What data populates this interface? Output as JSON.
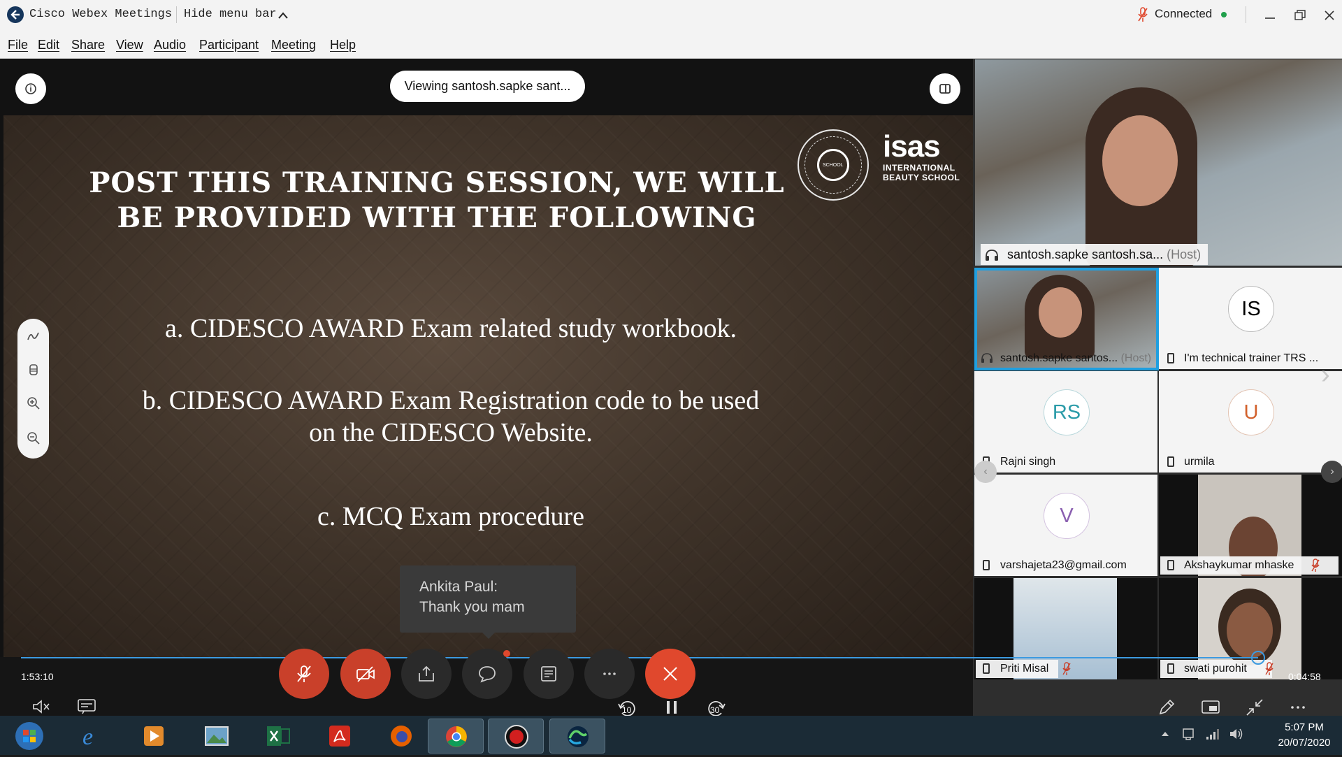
{
  "window": {
    "title": "Cisco Webex Meetings",
    "hide_menu_label": "Hide menu bar",
    "connection_status": "Connected"
  },
  "menu": [
    "File",
    "Edit",
    "Share",
    "View",
    "Audio",
    "Participant",
    "Meeting",
    "Help"
  ],
  "stage": {
    "viewing_label": "Viewing santosh.sapke sant..."
  },
  "slide": {
    "title_line1": "POST THIS TRAINING SESSION, WE WILL",
    "title_line2": "BE PROVIDED WITH THE FOLLOWING",
    "item_a": "a.  CIDESCO AWARD Exam related study workbook.",
    "item_b_line1": "b. CIDESCO AWARD Exam Registration code to be used",
    "item_b_line2": "on the CIDESCO Website.",
    "item_c": "c. MCQ Exam procedure",
    "logo_name": "isas",
    "logo_sub1": "INTERNATIONAL",
    "logo_sub2": "BEAUTY SCHOOL",
    "seal_text": "SCHOOL"
  },
  "chat_toast": {
    "sender": "Ankita Paul:",
    "message": "Thank you mam"
  },
  "playback": {
    "elapsed": "1:53:10",
    "remaining": "0:04:58",
    "rewind_seconds": "10",
    "forward_seconds": "30",
    "progress": 0.977
  },
  "participants": {
    "active_speaker": {
      "name": "santosh.sapke santosh.sa...",
      "role": "(Host)"
    },
    "tiles": [
      {
        "name": "santosh.sapke santos...",
        "role": "(Host)",
        "type": "video"
      },
      {
        "name": "I'm technical trainer TRS ...",
        "initials": "IS",
        "type": "avatar"
      },
      {
        "name": "Rajni singh",
        "initials": "RS",
        "type": "avatar"
      },
      {
        "name": "urmila",
        "initials": "U",
        "type": "avatar"
      },
      {
        "name": "varshajeta23@gmail.com",
        "initials": "V",
        "type": "avatar"
      },
      {
        "name": "Akshaykumar mhaske",
        "type": "video"
      },
      {
        "name": "Priti Misal",
        "type": "video"
      },
      {
        "name": "swati purohit",
        "type": "video"
      }
    ]
  },
  "taskbar": {
    "time": "5:07 PM",
    "date": "20/07/2020"
  },
  "colors": {
    "accent": "#3c9ae0",
    "end_call": "#e0482d",
    "muted": "#c9402a",
    "connected": "#20a04b"
  }
}
